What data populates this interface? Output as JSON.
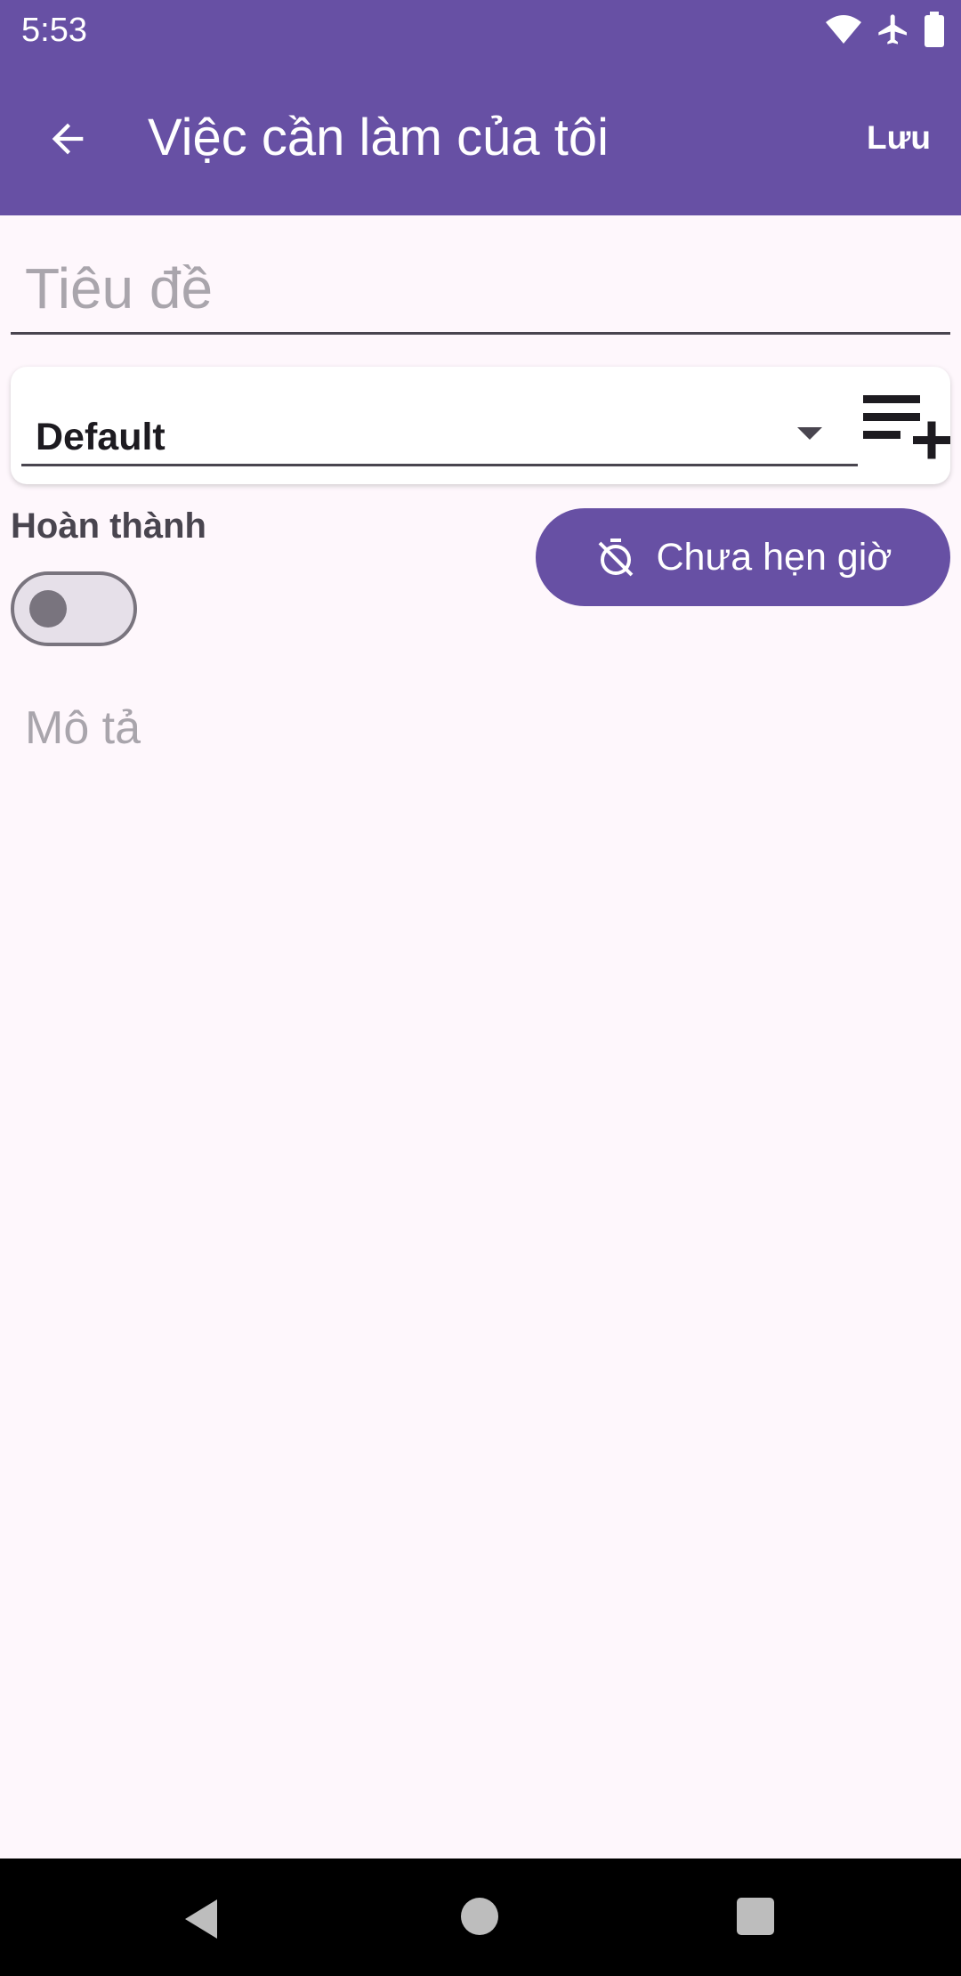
{
  "status_bar": {
    "time": "5:53",
    "icons": [
      "wifi-icon",
      "airplane-mode-icon",
      "battery-icon"
    ]
  },
  "app_bar": {
    "back_icon": "arrow-back-icon",
    "title": "Việc cần làm của tôi",
    "save_label": "Lưu"
  },
  "form": {
    "title_placeholder": "Tiêu đề",
    "title_value": "",
    "list_selected": "Default",
    "add_list_icon": "playlist-add-icon",
    "done_label": "Hoàn thành",
    "done_checked": false,
    "timer_icon": "timer-off-icon",
    "timer_label": "Chưa hẹn giờ",
    "description_placeholder": "Mô tả",
    "description_value": ""
  },
  "nav_bar": {
    "icons": [
      "nav-back-icon",
      "nav-home-icon",
      "nav-recents-icon"
    ]
  },
  "colors": {
    "primary": "#6750A4",
    "background": "#FEF7FC",
    "on_surface_variant": "#49454F",
    "outline": "#79747E"
  }
}
